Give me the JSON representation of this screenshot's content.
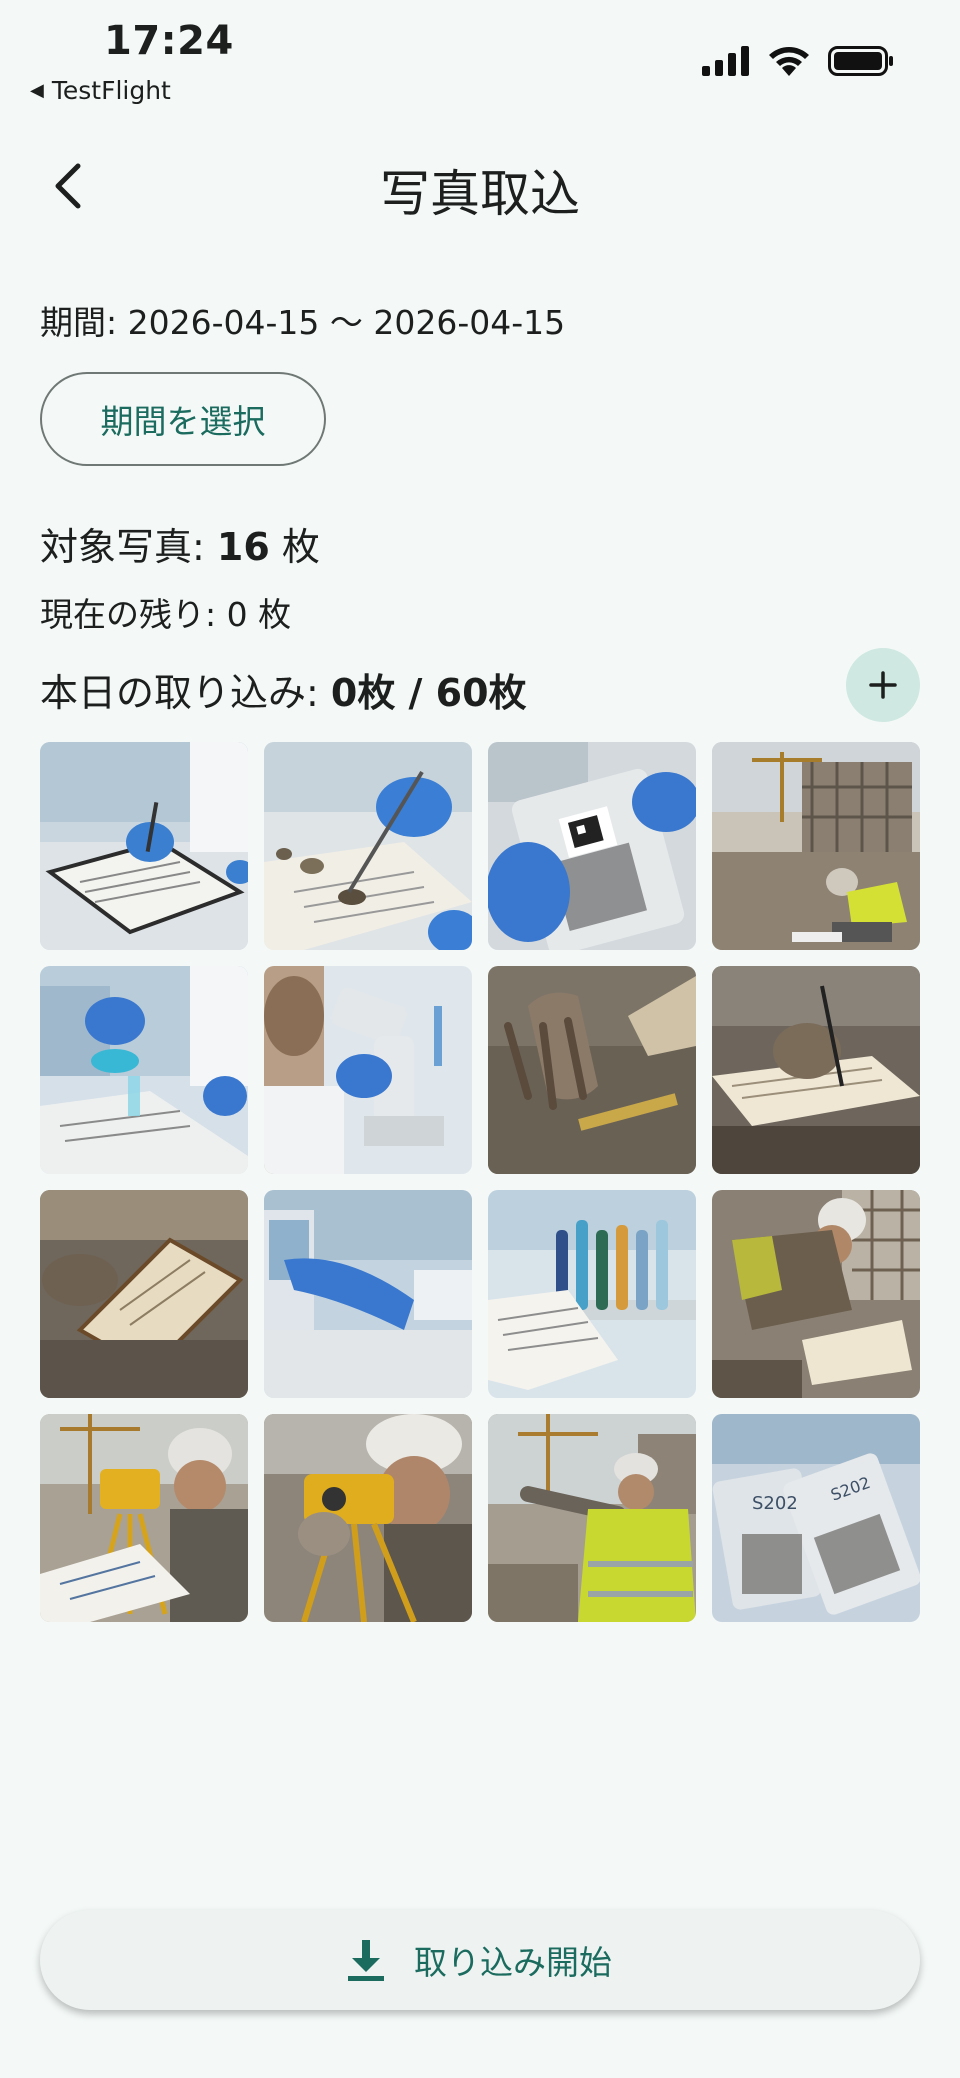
{
  "status_bar": {
    "time": "17:24",
    "back_app_label": "TestFlight",
    "icons": [
      "signal-icon",
      "wifi-icon",
      "battery-icon"
    ]
  },
  "header": {
    "title": "写真取込",
    "back_icon": "back-arrow-icon"
  },
  "period": {
    "label": "期間: 2026-04-15 〜 2026-04-15",
    "select_button": "期間を選択"
  },
  "stats": {
    "target_prefix": "対象写真: ",
    "target_count": "16",
    "target_suffix": " 枚",
    "remaining": "現在の残り: 0 枚",
    "today_prefix": "本日の取り込み: ",
    "today_value": "0枚 / 60枚",
    "add_icon": "plus-icon"
  },
  "photos": [
    "lab-notebook-writing",
    "soil-sample-tweezers",
    "qr-sample-bag",
    "construction-worker-kneeling",
    "lab-blue-liquid-beaker",
    "microscope-researcher",
    "hand-on-soil",
    "gloved-hand-writing-notebook",
    "dirty-notebook-on-ground",
    "lab-gloved-hand-equipment",
    "test-tubes-clipboard",
    "worker-measuring-site",
    "surveyor-level-blueprint",
    "surveyor-level-closeup",
    "worker-pointing-site",
    "sample-bags-labeled"
  ],
  "colors": {
    "accent": "#1b6b5f",
    "background": "#f4f9f7",
    "fab": "#cfe8e1"
  },
  "footer": {
    "import_button": "取り込み開始",
    "import_icon": "download-icon"
  }
}
